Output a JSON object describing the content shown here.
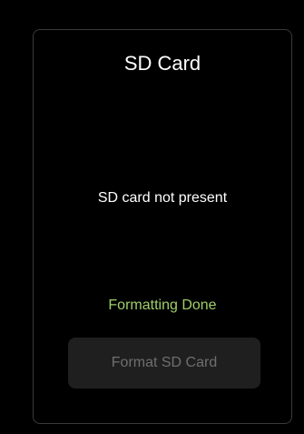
{
  "card": {
    "title": "SD Card",
    "status_text": "SD card not present",
    "format_status": "Formatting Done",
    "format_button_label": "Format SD Card"
  },
  "colors": {
    "background": "#000000",
    "card_border": "#3a3a3a",
    "title_text": "#ffffff",
    "success_text": "#9fcf6a",
    "button_background": "#1f1f1f",
    "button_text_disabled": "#6f6f6f"
  }
}
